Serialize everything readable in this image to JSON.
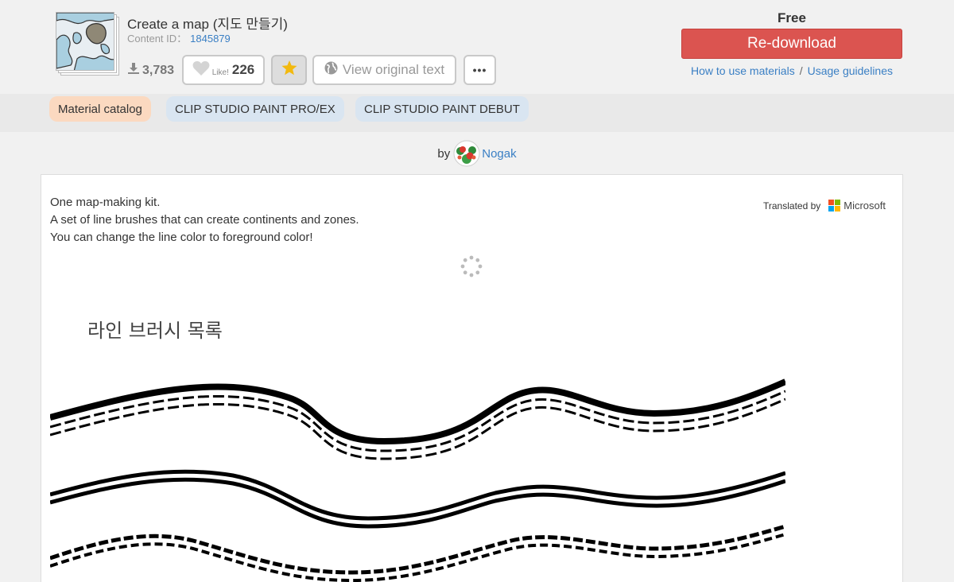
{
  "material": {
    "title": "Create a map (지도 만들기)",
    "content_id_label": "Content ID：",
    "content_id": "1845879",
    "download_count": "3,783",
    "like_label": "Like!",
    "like_count": "226",
    "view_original_label": "View original text",
    "more_label": "•••"
  },
  "purchase": {
    "price": "Free",
    "redownload_label": "Re-download",
    "how_to_use_label": "How to use materials",
    "separator": "/",
    "guidelines_label": "Usage guidelines"
  },
  "tags": [
    {
      "label": "Material catalog"
    },
    {
      "label": "CLIP STUDIO PAINT PRO/EX"
    },
    {
      "label": "CLIP STUDIO PAINT DEBUT"
    }
  ],
  "author": {
    "by_label": "by",
    "name": "Nogak"
  },
  "description": {
    "lines": [
      "One map-making kit.",
      "A set of line brushes that can create continents and zones.",
      "You can change the line color to foreground color!"
    ],
    "translated_by_label": "Translated by",
    "translator": "Microsoft"
  },
  "artwork": {
    "heading": "라인 브러시 목록"
  },
  "colors": {
    "accent_link": "#3a7fc4",
    "redownload_bg": "#db5450",
    "catalog_tag_bg": "#fbd9c0",
    "platform_tag_bg": "#d9e5f1",
    "star": "#f2b90f"
  },
  "icons": {
    "download": "download-icon",
    "like": "heart-icon",
    "favorite": "star-icon",
    "view_original": "globe-icon",
    "more": "ellipsis-icon",
    "loading": "spinner-icon"
  }
}
